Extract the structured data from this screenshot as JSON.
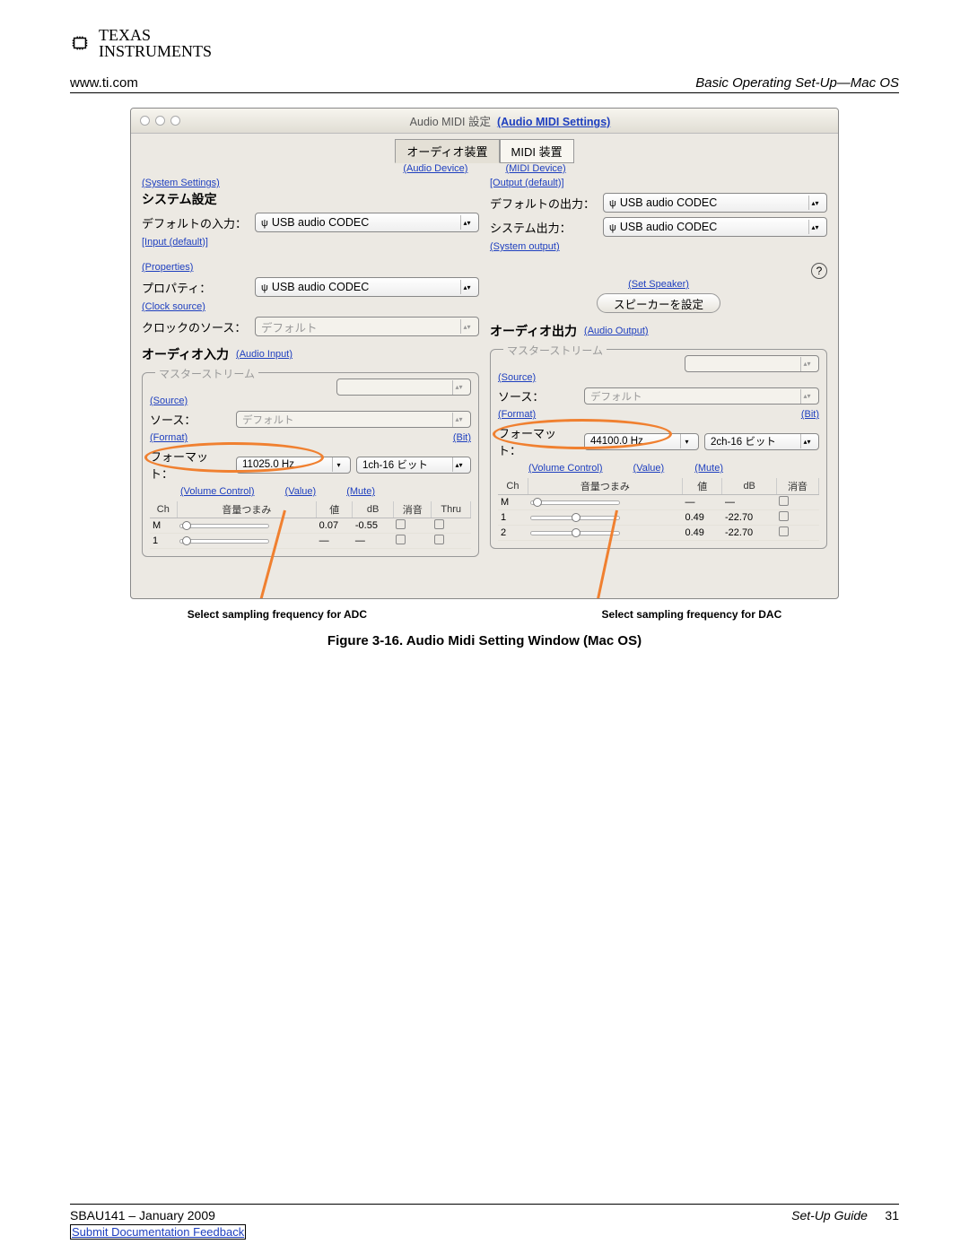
{
  "header": {
    "brand_prefix": "TEXAS",
    "brand_suffix": "INSTRUMENTS",
    "url": "www.ti.com",
    "section_title": "Basic Operating Set-Up—Mac OS"
  },
  "window": {
    "title_jp": "Audio MIDI 設定",
    "title_en": "(Audio MIDI Settings)",
    "tabs": {
      "audio_jp": "オーディオ装置",
      "midi_jp": "MIDI 装置",
      "audio_en": "(Audio Device)",
      "midi_en": "(MIDI Device)"
    }
  },
  "left": {
    "system_settings_en": "(System Settings)",
    "system_settings_jp": "システム設定",
    "default_input_jp": "デフォルトの入力：",
    "default_input_en": "[Input (default)]",
    "default_input_value": "USB audio CODEC",
    "properties_en": "(Properties)",
    "properties_jp": "プロパティ：",
    "properties_value": "USB audio CODEC",
    "clock_source_en": "(Clock source)",
    "clock_source_jp": "クロックのソース：",
    "clock_source_value": "デフォルト",
    "audio_input_jp": "オーディオ入力",
    "audio_input_en": "(Audio Input)",
    "master_stream": "マスターストリーム",
    "source_en": "(Source)",
    "source_label": "ソース：",
    "source_value": "デフォルト",
    "format_en": "(Format)",
    "bit_en": "(Bit)",
    "format_label": "フォーマット：",
    "a_rate": "11025.0 Hz",
    "a_bits": "1ch-16 ビット",
    "volume_control_en": "(Volume Control)",
    "value_en": "(Value)",
    "mute_en": "(Mute)",
    "th_ch": "Ch",
    "th_knob": "音量つまみ",
    "th_val": "値",
    "th_db": "dB",
    "th_mute": "消音",
    "th_thru": "Thru",
    "row_m": {
      "val": "0.07",
      "db": "-0.55"
    },
    "row_1": {
      "val": "—",
      "db": "—"
    }
  },
  "right": {
    "output_default_en": "[Output (default)]",
    "default_output_jp": "デフォルトの出力：",
    "default_output_value": "USB audio CODEC",
    "system_output_jp": "システム出力：",
    "system_output_en": "(System output)",
    "system_output_value": "USB audio CODEC",
    "set_speaker_en": "(Set Speaker)",
    "set_speaker_btn": "スピーカーを設定",
    "audio_output_jp": "オーディオ出力",
    "audio_output_en": "(Audio Output)",
    "master_stream": "マスターストリーム",
    "source_en": "(Source)",
    "source_label": "ソース：",
    "source_value": "デフォルト",
    "format_en": "(Format)",
    "bit_en": "(Bit)",
    "format_label": "フォーマット：",
    "b_rate": "44100.0 Hz",
    "b_bits": "2ch-16 ビット",
    "volume_control_en": "(Volume Control)",
    "value_en": "(Value)",
    "mute_en": "(Mute)",
    "th_ch": "Ch",
    "th_knob": "音量つまみ",
    "th_val": "値",
    "th_db": "dB",
    "th_mute": "消音",
    "row_m": {
      "val": "—",
      "db": "—"
    },
    "row_1": {
      "val": "0.49",
      "db": "-22.70"
    },
    "row_2": {
      "val": "0.49",
      "db": "-22.70"
    }
  },
  "callouts": {
    "adc": "Select sampling frequency for ADC",
    "dac": "Select sampling frequency for DAC"
  },
  "caption": "Figure 3-16. Audio Midi Setting Window (Mac OS)",
  "footer": {
    "doc_id": "SBAU141 – January 2009",
    "guide": "Set-Up Guide",
    "page": "31",
    "feedback": "Submit Documentation Feedback"
  }
}
